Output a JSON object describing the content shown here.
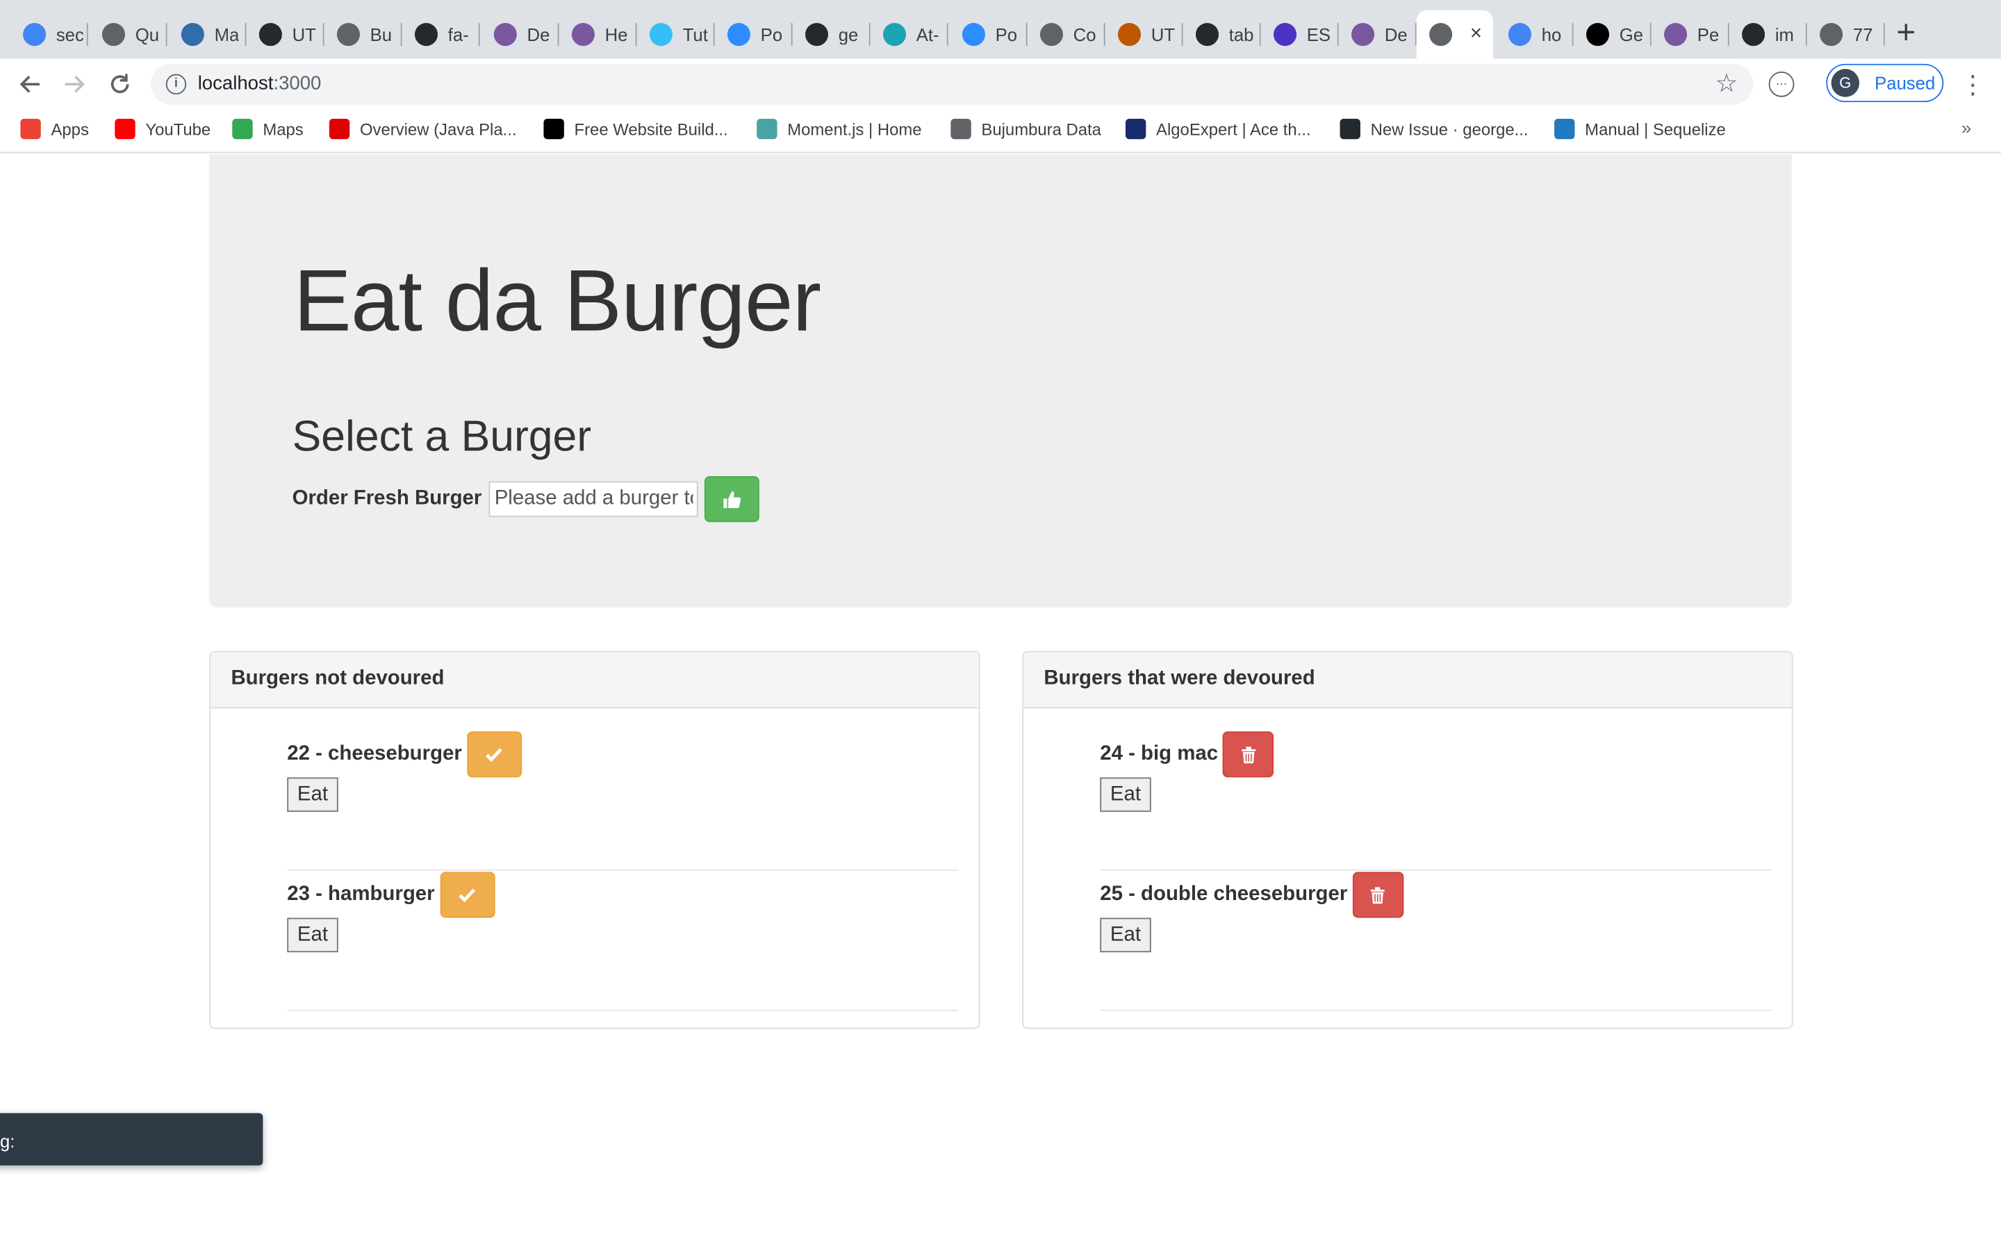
{
  "browser": {
    "tabs": [
      {
        "title": "sec",
        "icon": "google-icon",
        "color": "#4285f4"
      },
      {
        "title": "Qu",
        "icon": "globe-icon",
        "color": "#5f6368"
      },
      {
        "title": "Ma",
        "icon": "cube-icon",
        "color": "#2f6ea8"
      },
      {
        "title": "UT",
        "icon": "github-icon",
        "color": "#24292e"
      },
      {
        "title": "Bu",
        "icon": "globe-icon",
        "color": "#5f6368"
      },
      {
        "title": "fa-",
        "icon": "flag-icon",
        "color": "#24292e"
      },
      {
        "title": "De",
        "icon": "heroku-icon",
        "color": "#79589f"
      },
      {
        "title": "He",
        "icon": "heroku-icon",
        "color": "#79589f"
      },
      {
        "title": "Tut",
        "icon": "gem-icon",
        "color": "#38bdf8"
      },
      {
        "title": "Po",
        "icon": "zoom-icon",
        "color": "#2d8cff"
      },
      {
        "title": "ge",
        "icon": "github-icon",
        "color": "#24292e"
      },
      {
        "title": "At-",
        "icon": "stat-icon",
        "color": "#1aa3b0"
      },
      {
        "title": "Po",
        "icon": "zoom-icon",
        "color": "#2d8cff"
      },
      {
        "title": "Co",
        "icon": "globe-icon",
        "color": "#5f6368"
      },
      {
        "title": "UT",
        "icon": "shield-icon",
        "color": "#bf5700"
      },
      {
        "title": "tab",
        "icon": "github-icon",
        "color": "#24292e"
      },
      {
        "title": "ES",
        "icon": "eslint-icon",
        "color": "#4b32c3"
      },
      {
        "title": "De",
        "icon": "heroku-icon",
        "color": "#79589f"
      },
      {
        "title": "",
        "icon": "globe-icon",
        "color": "#5f6368",
        "active": true
      },
      {
        "title": "ho",
        "icon": "google-icon",
        "color": "#4285f4"
      },
      {
        "title": "Ge",
        "icon": "medium-icon",
        "color": "#000000"
      },
      {
        "title": "Pe",
        "icon": "heroku-icon",
        "color": "#79589f"
      },
      {
        "title": "im",
        "icon": "github-icon",
        "color": "#24292e"
      },
      {
        "title": "77",
        "icon": "globe-icon",
        "color": "#5f6368"
      }
    ],
    "new_tab": "+",
    "close_tab": "×",
    "url_host": "localhost",
    "url_port": ":3000",
    "profile_initial": "G",
    "profile_label": "Paused",
    "bookmarks": [
      {
        "label": "Apps",
        "icon": "apps-grid-icon",
        "color": "#ea4335"
      },
      {
        "label": "YouTube",
        "icon": "youtube-icon",
        "color": "#ff0000"
      },
      {
        "label": "Maps",
        "icon": "maps-icon",
        "color": "#34a853"
      },
      {
        "label": "Overview (Java Pla...",
        "icon": "oracle-icon",
        "color": "#e00000"
      },
      {
        "label": "Free Website Build...",
        "icon": "wix-icon",
        "color": "#000000"
      },
      {
        "label": "Moment.js | Home",
        "icon": "clock-icon",
        "color": "#4aa3a3"
      },
      {
        "label": "Bujumbura Data",
        "icon": "globe-icon",
        "color": "#5f6368"
      },
      {
        "label": "AlgoExpert | Ace th...",
        "icon": "atom-icon",
        "color": "#1a2b6d"
      },
      {
        "label": "New Issue · george...",
        "icon": "github-icon",
        "color": "#24292e"
      },
      {
        "label": "Manual | Sequelize",
        "icon": "sequelize-icon",
        "color": "#2379bd"
      }
    ],
    "bookmarks_more": "»"
  },
  "page": {
    "title": "Eat da Burger",
    "subtitle": "Select a Burger",
    "order_label": "Order Fresh Burger",
    "order_placeholder": "Please add a burger to",
    "colors": {
      "success": "#5cb85c",
      "warning": "#f0ad4e",
      "danger": "#d9534f"
    },
    "not_devoured": {
      "heading": "Burgers not devoured",
      "items": [
        {
          "label": "22 - cheeseburger",
          "eat": "Eat"
        },
        {
          "label": "23 - hamburger",
          "eat": "Eat"
        }
      ]
    },
    "devoured": {
      "heading": "Burgers that were devoured",
      "items": [
        {
          "label": "24 - big mac",
          "eat": "Eat"
        },
        {
          "label": "25 - double cheeseburger",
          "eat": "Eat"
        }
      ]
    }
  },
  "toast": {
    "text": "g:"
  }
}
